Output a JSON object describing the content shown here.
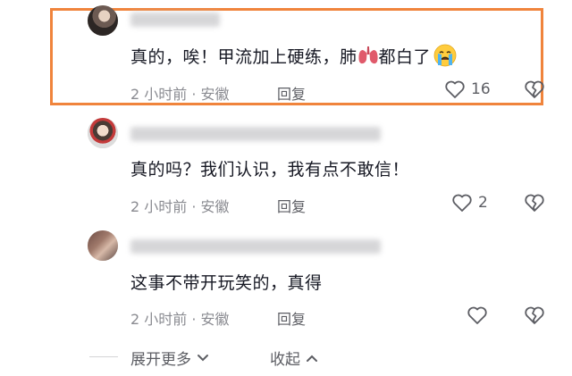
{
  "comments": [
    {
      "text_before": "真的，唉！甲流加上硬练，肺",
      "text_after": "都白了",
      "emoji_after_text": "crying-face-emoji",
      "emoji_inline": "lungs-emoji",
      "time_location": "2 小时前 · 安徽",
      "reply_label": "回复",
      "like_count": "16",
      "highlighted": true
    },
    {
      "text": "真的吗？我们认识，我有点不敢信！",
      "time_location": "2 小时前 · 安徽",
      "reply_label": "回复",
      "like_count": "2"
    },
    {
      "text": "这事不带开玩笑的，真得",
      "time_location": "2 小时前 · 安徽",
      "reply_label": "回复",
      "like_count": ""
    }
  ],
  "footer": {
    "expand_more": "展开更多",
    "collapse": "收起"
  },
  "colors": {
    "highlight_border": "#f0843c",
    "text": "#161823",
    "meta": "#8a8b91"
  }
}
